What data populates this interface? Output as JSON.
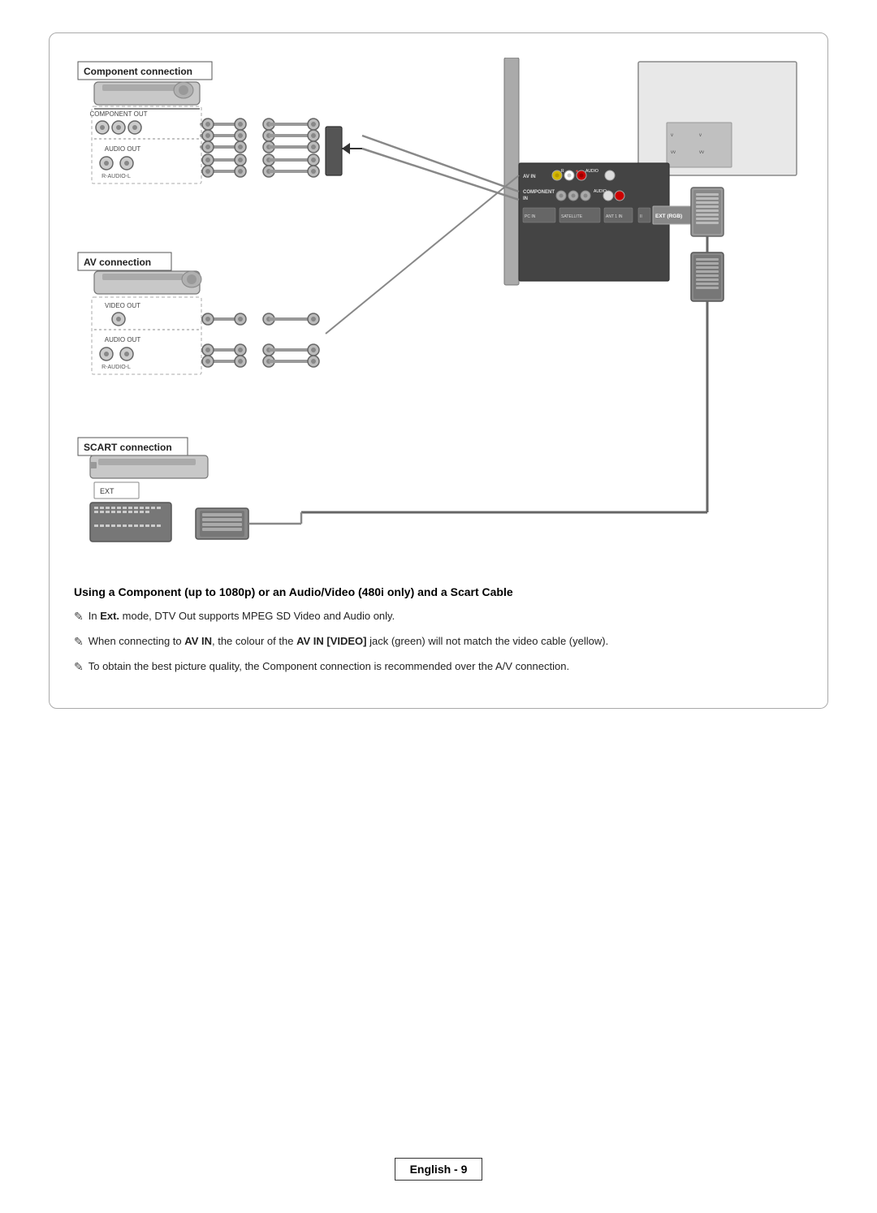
{
  "page": {
    "background": "#ffffff"
  },
  "diagram": {
    "component_label": "Component connection",
    "av_label": "AV connection",
    "scart_label": "SCART connection"
  },
  "section_title": "Using a Component (up to 1080p) or an Audio/Video (480i only) and a Scart Cable",
  "notes": [
    {
      "id": "note1",
      "text": "In ",
      "bold_part": "Ext.",
      "rest": " mode, DTV Out supports MPEG SD Video and Audio only."
    },
    {
      "id": "note2",
      "text": "When connecting to ",
      "bold1": "AV IN",
      "middle": ", the colour of the ",
      "bold2": "AV IN [VIDEO]",
      "rest": " jack (green) will not match the video cable (yellow)."
    },
    {
      "id": "note3",
      "text": "To obtain the best picture quality, the Component connection is recommended over the A/V connection."
    }
  ],
  "footer": {
    "text": "English - 9"
  }
}
